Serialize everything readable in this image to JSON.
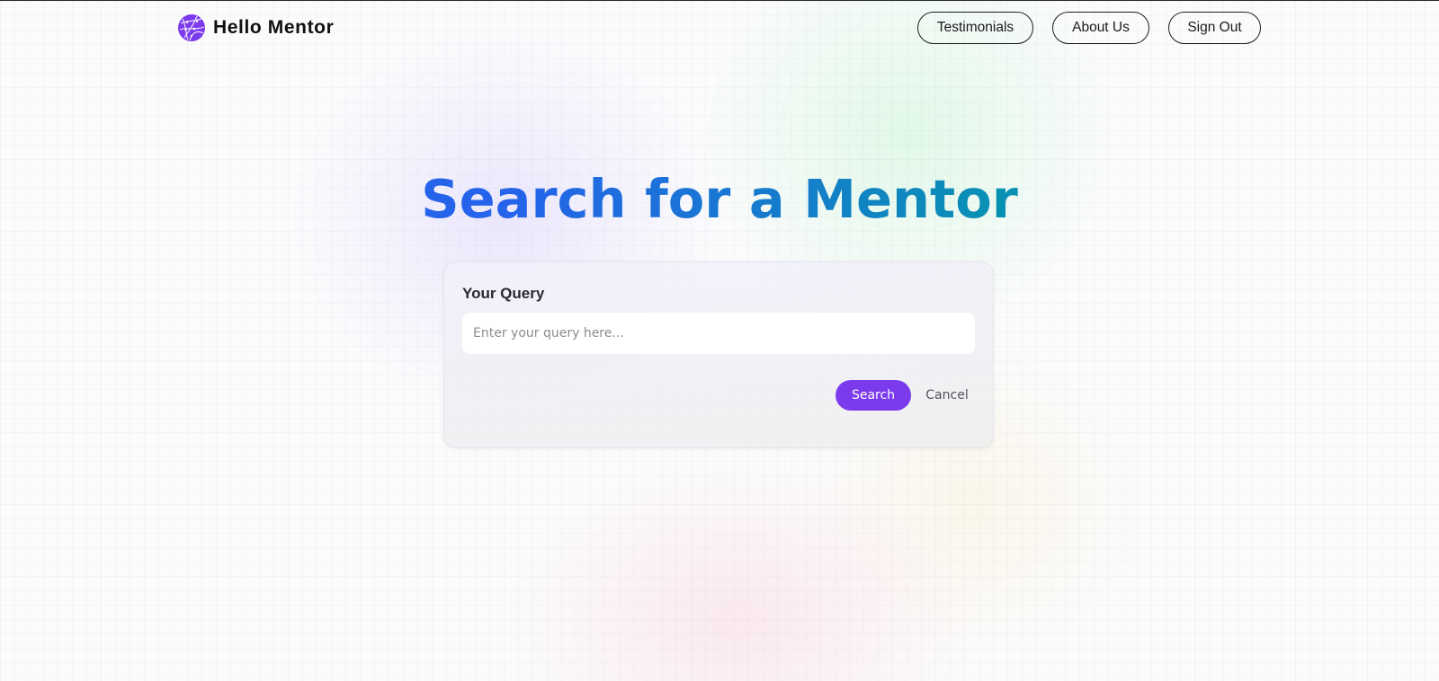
{
  "brand": {
    "name": "Hello Mentor",
    "logo_icon": "globe-network-icon",
    "logo_color": "#7c3aed"
  },
  "nav": {
    "items": [
      {
        "label": "Testimonials"
      },
      {
        "label": "About Us"
      },
      {
        "label": "Sign Out"
      }
    ]
  },
  "hero": {
    "title": "Search for a Mentor",
    "gradient_start": "#2563eb",
    "gradient_end": "#0891b2"
  },
  "query_form": {
    "label": "Your Query",
    "input_value": "",
    "input_placeholder": "Enter your query here...",
    "search_label": "Search",
    "cancel_label": "Cancel",
    "accent_color": "#7c3aed"
  }
}
